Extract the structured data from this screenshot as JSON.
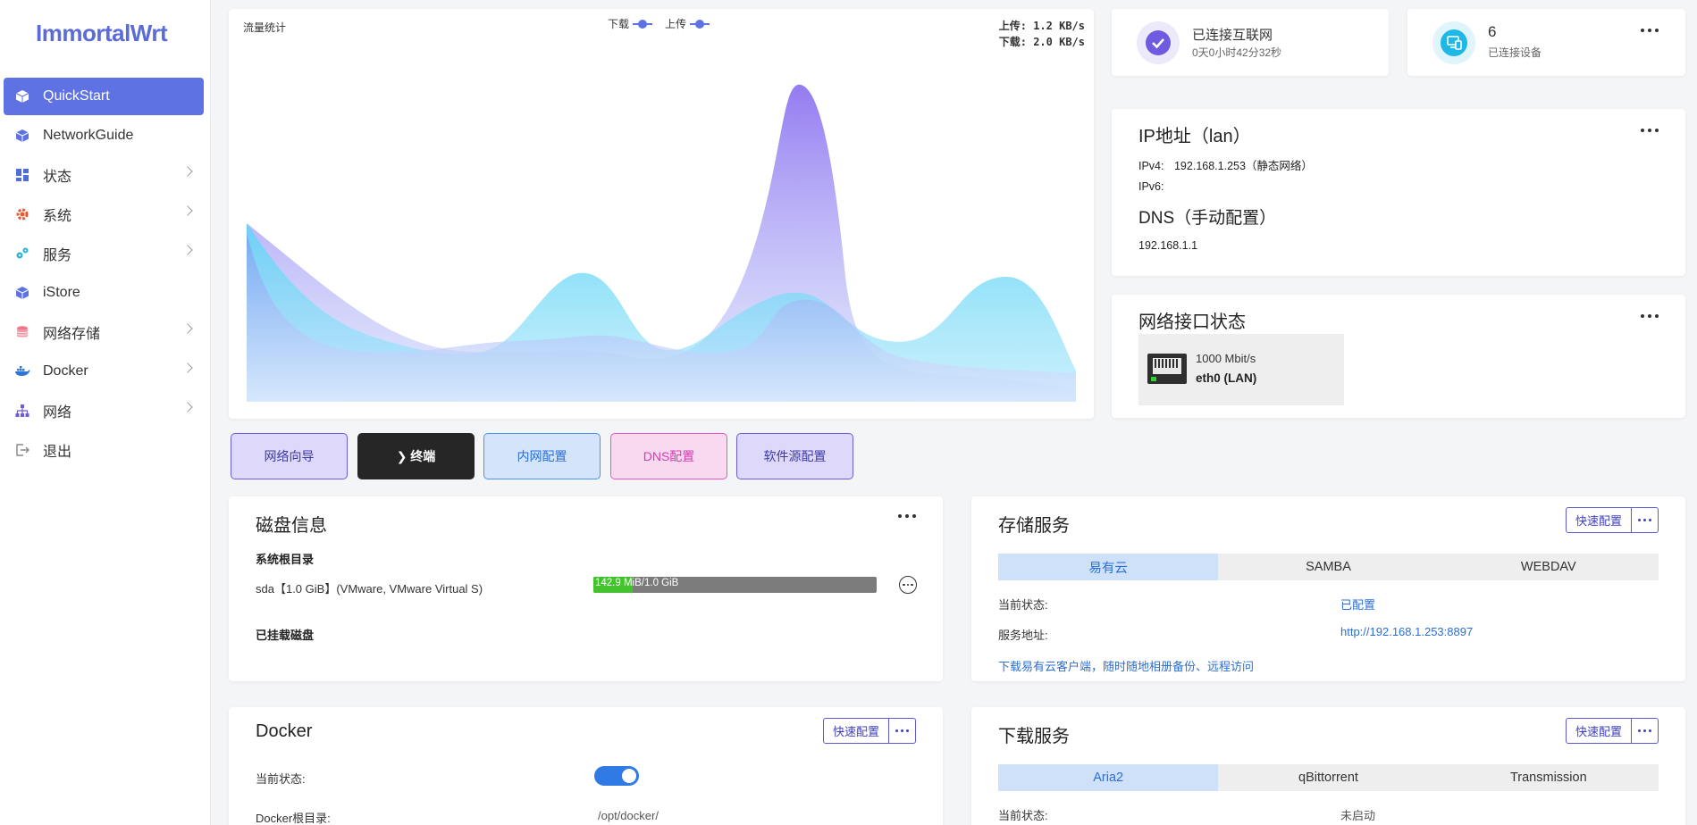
{
  "app": {
    "logo": "ImmortalWrt"
  },
  "sidebar": {
    "items": [
      {
        "label": "QuickStart",
        "active": true,
        "arrow": false
      },
      {
        "label": "NetworkGuide",
        "active": false,
        "arrow": false
      },
      {
        "label": "状态",
        "active": false,
        "arrow": true
      },
      {
        "label": "系统",
        "active": false,
        "arrow": true
      },
      {
        "label": "服务",
        "active": false,
        "arrow": true
      },
      {
        "label": "iStore",
        "active": false,
        "arrow": false
      },
      {
        "label": "网络存储",
        "active": false,
        "arrow": true
      },
      {
        "label": "Docker",
        "active": false,
        "arrow": true
      },
      {
        "label": "网络",
        "active": false,
        "arrow": true
      },
      {
        "label": "退出",
        "active": false,
        "arrow": false
      }
    ]
  },
  "traffic": {
    "title": "流量统计",
    "legend_download": "下载",
    "legend_upload": "上传",
    "upload_rate": "上传: 1.2 KB/s",
    "download_rate": "下载: 2.0 KB/s"
  },
  "internet": {
    "status": "已连接互联网",
    "uptime": "0天0小时42分32秒"
  },
  "devices": {
    "count": "6",
    "label": "已连接设备"
  },
  "ip": {
    "title": "IP地址（lan）",
    "ipv4_label": "IPv4:",
    "ipv4_value": "192.168.1.253（静态网络）",
    "ipv6_label": "IPv6:",
    "dns_title": "DNS（手动配置）",
    "dns_value": "192.168.1.1"
  },
  "iface": {
    "title": "网络接口状态",
    "speed": "1000 Mbit/s",
    "name": "eth0 (LAN)"
  },
  "quick_buttons": [
    {
      "label": "网络向导"
    },
    {
      "label": "❯ 终端"
    },
    {
      "label": "内网配置"
    },
    {
      "label": "DNS配置"
    },
    {
      "label": "软件源配置"
    }
  ],
  "disk": {
    "title": "磁盘信息",
    "root_label": "系统根目录",
    "disk_name": "sda【1.0 GiB】(VMware, VMware Virtual S)",
    "usage_text": "142.9 MiB/1.0 GiB",
    "usage_fraction": 0.14,
    "mounted_label": "已挂载磁盘"
  },
  "storage": {
    "title": "存储服务",
    "quick_config": "快速配置",
    "tabs": [
      "易有云",
      "SAMBA",
      "WEBDAV"
    ],
    "status_label": "当前状态:",
    "status_value": "已配置",
    "addr_label": "服务地址:",
    "addr_value": "http://192.168.1.253:8897",
    "download_link": "下载易有云客户端，随时随地相册备份、远程访问"
  },
  "docker": {
    "title": "Docker",
    "quick_config": "快速配置",
    "status_label": "当前状态:",
    "enabled": true,
    "root_label": "Docker根目录:",
    "root_value": "/opt/docker/"
  },
  "downloads": {
    "title": "下载服务",
    "quick_config": "快速配置",
    "tabs": [
      "Aria2",
      "qBittorrent",
      "Transmission"
    ],
    "status_label": "当前状态:",
    "status_value": "未启动"
  },
  "colors": {
    "accent": "#5e72e4",
    "link": "#2b6fd6"
  }
}
